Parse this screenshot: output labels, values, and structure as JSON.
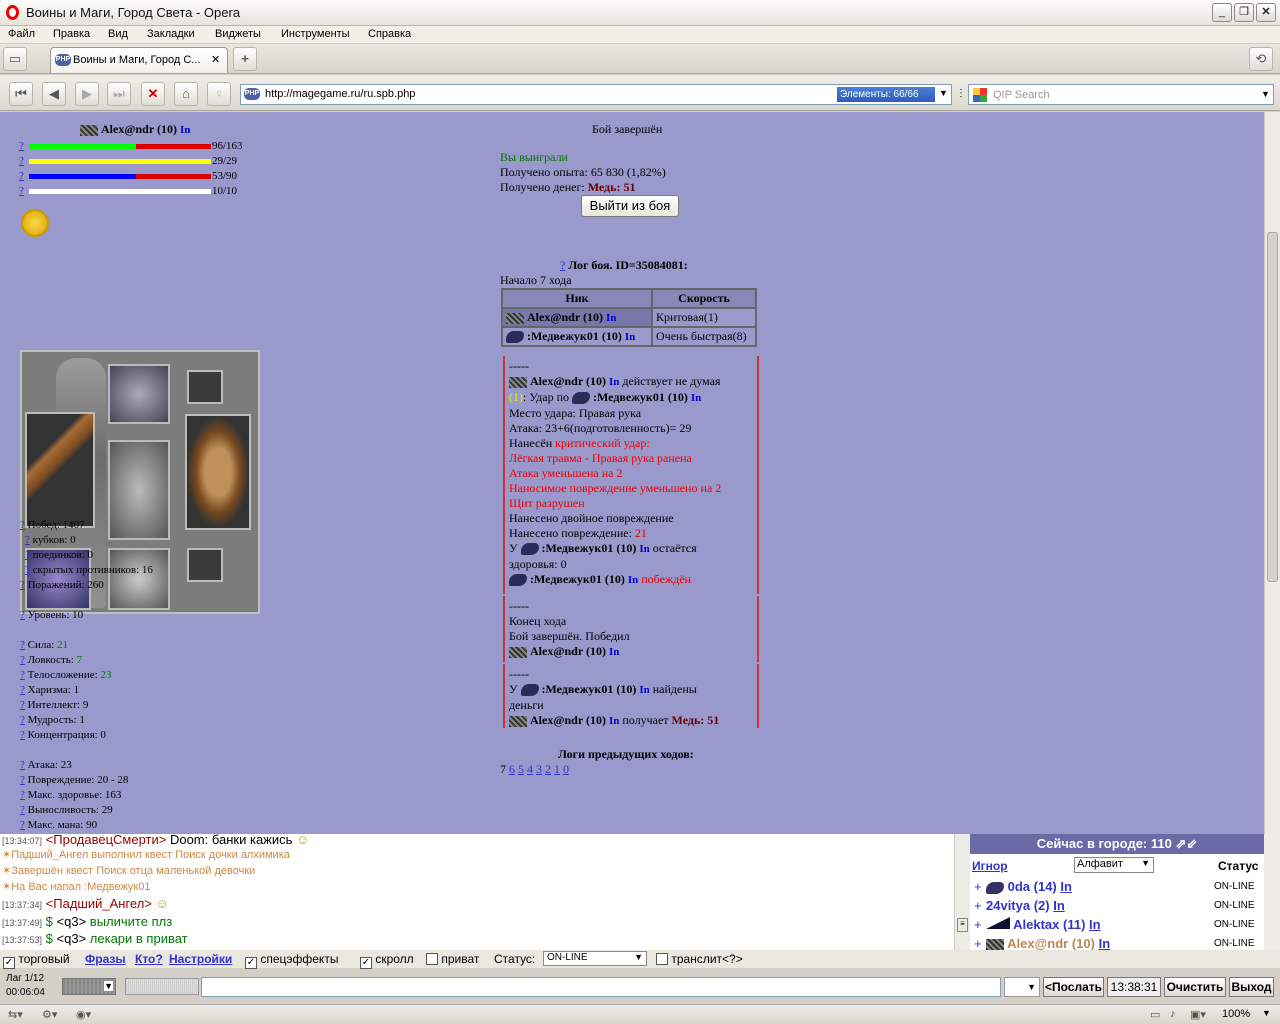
{
  "window": {
    "title": "Воины и Маги, Город Света - Opera"
  },
  "menu": [
    "Файл",
    "Правка",
    "Вид",
    "Закладки",
    "Виджеты",
    "Инструменты",
    "Справка"
  ],
  "tab": {
    "title": "Воины и Маги, Город С..."
  },
  "address": {
    "url": "http://magegame.ru/ru.spb.php",
    "elements": "Элементы:   66/66"
  },
  "search": {
    "placeholder": "QIP Search"
  },
  "player": {
    "name": "Alex@ndr (10)",
    "in": "In",
    "bars": [
      {
        "label": "96/163",
        "fill": 0.59,
        "color": "#00ff00"
      },
      {
        "label": "29/29",
        "fill": 1.0,
        "color": "#ffff00"
      },
      {
        "label": "53/90",
        "fill": 0.59,
        "color": "#0000ff"
      },
      {
        "label": "10/10",
        "fill": 1.0,
        "color": "#ffffff"
      }
    ],
    "q": "?"
  },
  "stats": {
    "wins": "Побед: 1407",
    "cups": "кубков: 0",
    "duels": "поединков: 0",
    "hidden": "скрытых противников: 16",
    "losses": "Поражений: 260",
    "level": "Уровень: 10",
    "str_l": "Сила: ",
    "str": "21",
    "agi_l": "Ловкость: ",
    "agi": "7",
    "con_l": "Телосложение: ",
    "con": "23",
    "cha": "Харизма: 1",
    "int": "Интеллект: 9",
    "wis": "Мудрость: 1",
    "conc": "Концентрация: 0",
    "atk": "Атака: 23",
    "dmg": "Повреждение: 20 - 28",
    "hp": "Макс. здоровье: 163",
    "end": "Выносливость: 29",
    "mana": "Макс. мана: 90"
  },
  "battle": {
    "finished": "Бой завершён",
    "won": "Вы выиграли",
    "exp": "Получено опыта: 65 830 (1,82%)",
    "money_l": "Получено денег: ",
    "money": "Медь: 51",
    "exit_btn": "Выйти из боя",
    "log_title": "Лог боя. ID=35084081:",
    "turn": "Начало 7 хода",
    "table": {
      "h_nick": "Ник",
      "h_speed": "Скорость",
      "r1_name": "Alex@ndr (10)",
      "r1_in": "In",
      "r1_speed": "Критовая(1)",
      "r2_name": ":Медвежук01 (10)",
      "r2_in": "In",
      "r2_speed": "Очень быстрая(8)"
    },
    "b1": {
      "sep": "-----",
      "actor": "Alex@ndr (10)",
      "in": "In",
      "act": " действует не думая",
      "n": "(1)",
      "hit": ": Удар по ",
      "target": ":Медвежук01 (10)",
      "place": "Место удара: Правая рука",
      "attack": "Атака: 23+6(подготовленность)= 29",
      "dealt": "Нанесён ",
      "crit": "критический удар:",
      "l1": "Лёгкая травма - Правая рука ранена",
      "l2": "Атака уменьшена на 2",
      "l3": "Наносимое повреждение уменьшено на 2",
      "l4": "Щит разрушен",
      "dbl": "Нанесено двойное повреждение",
      "dmg_l": "Нанесено повреждение: ",
      "dmg": "21",
      "hp_pre": "У ",
      "hp_post": " остаётся",
      "hp2": "здоровья: 0",
      "win": " побеждён"
    },
    "b2": {
      "sep": "-----",
      "end": "Конец хода",
      "fin": "Бой завершён. Победил",
      "who": "Alex@ndr (10)",
      "in": "In"
    },
    "b3": {
      "sep": "-----",
      "pre": "У ",
      "t": ":Медвежук01 (10)",
      "in": "In",
      "found": " найдены",
      "found2": "деньги",
      "who": "Alex@ndr (10)",
      "get": " получает ",
      "money": "Медь: 51"
    },
    "prev": "Логи предыдущих ходов:",
    "cur": "7",
    "pages": [
      "6",
      "5",
      "4",
      "3",
      "2",
      "1",
      "0"
    ]
  },
  "chat": [
    {
      "ts": "[13:34:07]",
      "nick": "<ПродавецСмерти>",
      "text": " Doom: банки кажись"
    },
    {
      "sys": "Падший_Ангел выполнил квест Поиск дочки алхимика"
    },
    {
      "sys": "Завершён квест Поиск отца маленькой девочки"
    },
    {
      "sys": "На Вас напал :Медвежук01"
    },
    {
      "ts": "[13:37:34]",
      "nick": "<Падший_Ангел>",
      "text": ""
    },
    {
      "ts": "[13:37:49]",
      "pre": "$",
      "nick": " <q3>",
      "text": " выличите плз"
    },
    {
      "ts": "[13:37:53]",
      "pre": "$",
      "nick": " <q3>",
      "text": " лекари в приват"
    }
  ],
  "online": {
    "header": "Сейчас в городе: 110",
    "ignore": "Игнор",
    "sort": "Алфавит",
    "status_h": "Статус",
    "users": [
      {
        "plus": "+",
        "name": "0da (14)",
        "in": "In",
        "st": "ON-LINE"
      },
      {
        "plus": "+",
        "name": "24vitya (2)",
        "in": "In",
        "st": "ON-LINE"
      },
      {
        "plus": "+",
        "name": "Alektax (11)",
        "in": "In",
        "st": "ON-LINE"
      },
      {
        "plus": "+",
        "name": "Alex@ndr (10)",
        "in": "In",
        "st": "ON-LINE"
      }
    ]
  },
  "controls": {
    "trade": "торговый",
    "phrases": "Фразы",
    "who": "Кто?",
    "settings": "Настройки",
    "fx": "спецэффекты",
    "scroll": "скролл",
    "priv": "приват",
    "status_l": "Статус:",
    "status": "ON-LINE",
    "translit": "транслит",
    "q": "<?>"
  },
  "input": {
    "lag": "Лаг 1/12",
    "time": "00:06:04",
    "send": "<Послать",
    "clock": "13:38:31",
    "clear": "Очистить",
    "exit": "Выход"
  },
  "status": {
    "zoom": "100%"
  }
}
